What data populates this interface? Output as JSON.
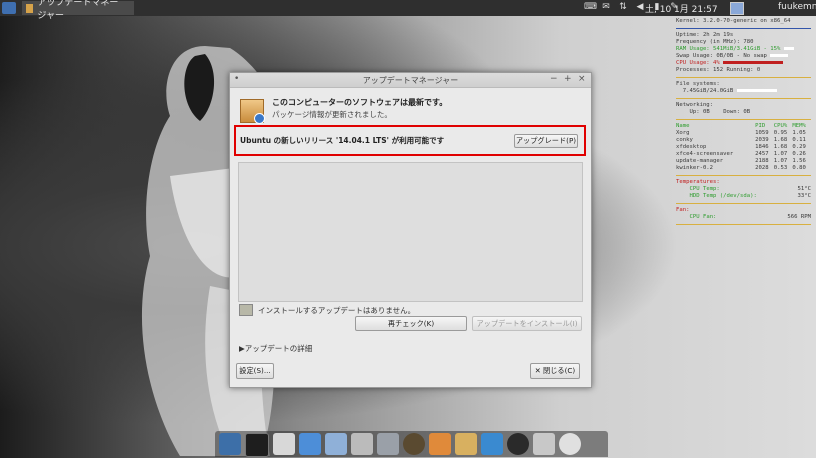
{
  "panel": {
    "window_task_title": "アップデートマネージャー",
    "clock": "土, 10 1月  21:57",
    "user": "fuukemn",
    "tray_icons": [
      "keyboard-icon",
      "mail-icon",
      "network-icon",
      "volume-icon",
      "battery-icon",
      "pen-icon"
    ]
  },
  "conky": {
    "kernel": "Kernel: 3.2.0-70-generic on x86_64",
    "uptime": "Uptime: 2h 2m 19s",
    "freq": "Frequency (in MHz): 780",
    "ram": "RAM Usage: 541MiB/3.41GiB - 15%",
    "swap": "Swap Usage: 0B/0B - No swap",
    "cpu": "CPU Usage: 4%",
    "processes": "Processes: 152  Running: 0",
    "fs_title": "File systems:",
    "fs_value": "7.45GiB/24.0GiB",
    "net_title": "Networking:",
    "net_up": "Up: 0B",
    "net_down": "Down: 0B",
    "top_headers": [
      "Name",
      "PID",
      "CPU%",
      "MEM%"
    ],
    "top_rows": [
      [
        "Xorg",
        "1059",
        "0.95",
        "1.05"
      ],
      [
        "conky",
        "2039",
        "1.68",
        "0.11"
      ],
      [
        "xfdesktop",
        "1846",
        "1.68",
        "0.29"
      ],
      [
        "xfce4-screensaver",
        "2457",
        "1.07",
        "0.26"
      ],
      [
        "update-manager",
        "2188",
        "1.07",
        "1.56"
      ],
      [
        "kwinker-0.2",
        "2028",
        "0.53",
        "0.80"
      ]
    ],
    "temp_title": "Temperatures:",
    "temp_cpu_label": "CPU Temp:",
    "temp_cpu_value": "51°C",
    "temp_hdd_label": "HDD Temp (/dev/sda):",
    "temp_hdd_value": "33°C",
    "fan_title": "Fan:",
    "fan_label": "CPU Fan:",
    "fan_value": "566 RPM"
  },
  "window": {
    "title": "アップデートマネージャー",
    "up_to_date": "このコンピューターのソフトウェアは最新です。",
    "pkg_info_updated": "パッケージ情報が更新されました。",
    "release_notice": "Ubuntu の新しいリリース '14.04.1 LTS' が利用可能です",
    "upgrade_button": "アップグレード(P)",
    "no_updates": "インストールするアップデートはありません。",
    "recheck_button": "再チェック(K)",
    "install_button": "アップデートをインストール(I)",
    "details": "▶アップデートの詳細",
    "settings_button": "設定(S)...",
    "close_button": "閉じる(C)"
  },
  "dock": {
    "items": [
      "desktop-icon",
      "terminal-icon",
      "files-icon",
      "safari-icon",
      "screenshot-icon",
      "mixer-icon",
      "search-icon",
      "audio-icon",
      "image-editor-icon",
      "folder-icon",
      "update-icon",
      "disc-icon",
      "trash-icon",
      "restart-icon"
    ]
  },
  "colors": {
    "highlight": "#e00000",
    "panel": "#2f2f2f",
    "window": "#eaeaea"
  }
}
